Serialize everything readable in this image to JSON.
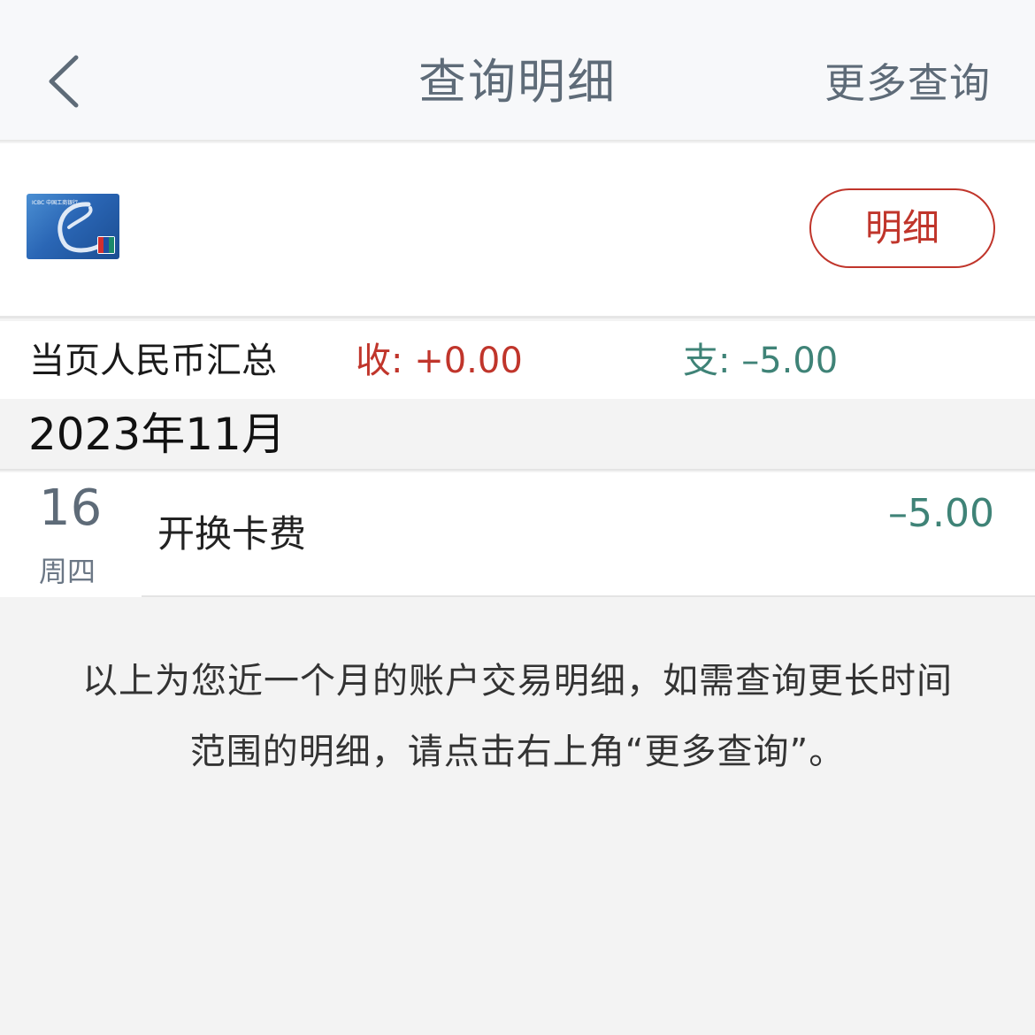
{
  "navbar": {
    "back_icon": "chevron-left-icon",
    "title": "查询明细",
    "more_query_label": "更多查询"
  },
  "card": {
    "image": "icbc-e-card",
    "bank_text": "ICBC 中国工商银行",
    "network_text": "UnionPay 银联",
    "detail_button_label": "明细"
  },
  "summary": {
    "label": "当页人民币汇总",
    "income": "收: +0.00",
    "expense": "支: –5.00"
  },
  "month": {
    "label": "2023年11月"
  },
  "transactions": [
    {
      "day": "16",
      "weekday": "周四",
      "description": "开换卡费",
      "amount": "–5.00"
    }
  ],
  "note": {
    "line1": "以上为您近一个月的账户交易明细，如需查询更长时间",
    "line2": "范围的明细，请点击右上角“更多查询”。"
  },
  "colors": {
    "accent_red": "#c0352b",
    "expense_green": "#3f8377",
    "nav_text": "#5e6b78"
  }
}
